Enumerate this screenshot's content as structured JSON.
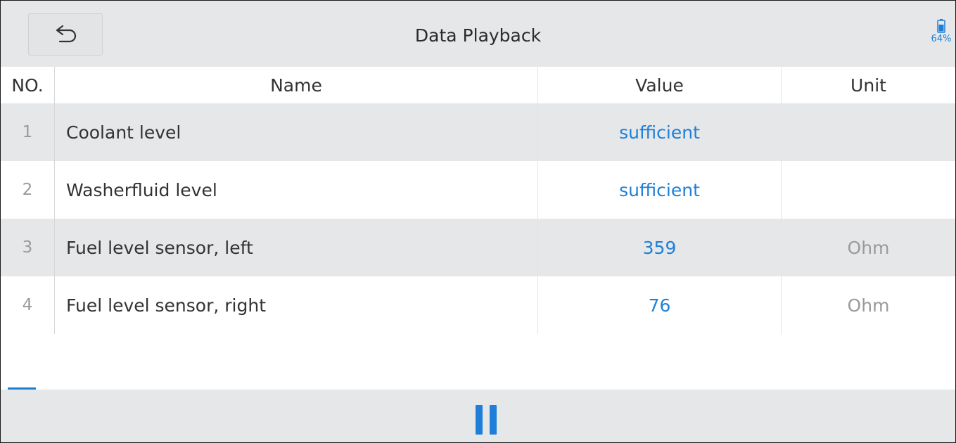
{
  "header": {
    "title": "Data Playback",
    "back_icon": "back-arrow-icon",
    "battery": {
      "icon": "battery-icon",
      "label": "64%"
    }
  },
  "table": {
    "columns": {
      "no": "NO.",
      "name": "Name",
      "value": "Value",
      "unit": "Unit"
    },
    "rows": [
      {
        "no": "1",
        "name": "Coolant level",
        "value": "sufficient",
        "unit": ""
      },
      {
        "no": "2",
        "name": "Washerfluid level",
        "value": "sufficient",
        "unit": ""
      },
      {
        "no": "3",
        "name": "Fuel level sensor, left",
        "value": "359",
        "unit": "Ohm"
      },
      {
        "no": "4",
        "name": "Fuel level sensor, right",
        "value": "76",
        "unit": "Ohm"
      }
    ]
  },
  "footer": {
    "pause_icon": "pause-icon"
  },
  "colors": {
    "accent": "#1f7fd8",
    "header_bg": "#e6e7e9",
    "row_shade": "#e6e7e9"
  }
}
